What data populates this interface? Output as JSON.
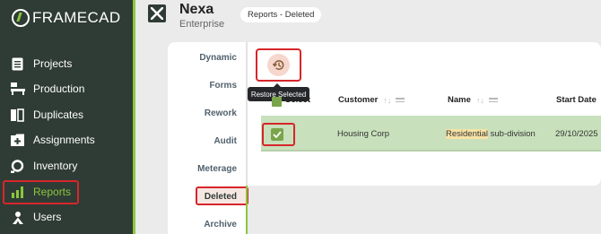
{
  "sidebar": {
    "logo_text": "FRAMECAD",
    "items": [
      {
        "label": "Projects",
        "icon": "projects-icon"
      },
      {
        "label": "Production",
        "icon": "production-icon"
      },
      {
        "label": "Duplicates",
        "icon": "duplicates-icon"
      },
      {
        "label": "Assignments",
        "icon": "assignments-icon"
      },
      {
        "label": "Inventory",
        "icon": "inventory-icon"
      },
      {
        "label": "Reports",
        "icon": "reports-icon",
        "active": true
      },
      {
        "label": "Users",
        "icon": "users-icon"
      }
    ]
  },
  "header": {
    "app_name": "Nexa",
    "edition": "Enterprise",
    "breadcrumb": "Reports - Deleted"
  },
  "report_tabs": [
    "Dynamic",
    "Forms",
    "Rework",
    "Audit",
    "Meterage",
    "Deleted",
    "Archive"
  ],
  "active_tab": "Deleted",
  "toolbar": {
    "restore_tooltip": "Restore Selected"
  },
  "table": {
    "columns": [
      "Select",
      "Customer",
      "Name",
      "Start Date"
    ],
    "rows": [
      {
        "selected": true,
        "customer": "Housing Corp",
        "name_highlight": "Residential",
        "name_rest": " sub-division",
        "start_date": "29/10/2025"
      }
    ]
  },
  "colors": {
    "sidebar_bg": "#2f3c35",
    "accent_green": "#8cc63f",
    "selected_row": "#c8e1bc",
    "highlight_red": "#d6262b"
  }
}
